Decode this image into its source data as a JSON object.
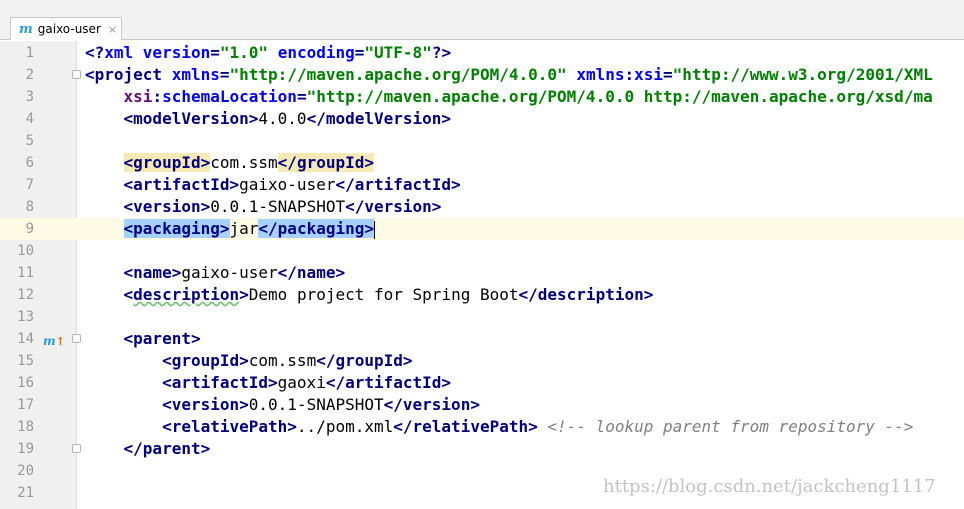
{
  "tab": {
    "icon": "m",
    "label": "gaixo-user",
    "close": "×"
  },
  "lines": [
    {
      "num": "1",
      "segs": [
        [
          "t",
          "<?"
        ],
        [
          "a",
          "xml version"
        ],
        [
          "t",
          "="
        ],
        [
          "v",
          "\"1.0\""
        ],
        [
          "t",
          " "
        ],
        [
          "a",
          "encoding"
        ],
        [
          "t",
          "="
        ],
        [
          "v",
          "\"UTF-8\""
        ],
        [
          "t",
          "?>"
        ]
      ]
    },
    {
      "num": "2",
      "segs": [
        [
          "t",
          "<project "
        ],
        [
          "a",
          "xmlns"
        ],
        [
          "t",
          "="
        ],
        [
          "v",
          "\"http://maven.apache.org/POM/4.0.0\""
        ],
        [
          "t",
          " "
        ],
        [
          "a",
          "xmlns"
        ],
        [
          "t",
          ":"
        ],
        [
          "a",
          "xsi"
        ],
        [
          "t",
          "="
        ],
        [
          "v",
          "\"http://www.w3.org/2001/XML"
        ]
      ]
    },
    {
      "num": "3",
      "segs": [
        [
          "x",
          "    xsi"
        ],
        [
          "t",
          ":"
        ],
        [
          "a",
          "schemaLocation"
        ],
        [
          "t",
          "="
        ],
        [
          "v",
          "\"http://maven.apache.org/POM/4.0.0 http://maven.apache.org/xsd/ma"
        ]
      ]
    },
    {
      "num": "4",
      "segs": [
        [
          "p",
          "    "
        ],
        [
          "t",
          "<modelVersion>"
        ],
        [
          "p",
          "4.0.0"
        ],
        [
          "t",
          "</modelVersion>"
        ]
      ]
    },
    {
      "num": "5",
      "segs": []
    },
    {
      "num": "6",
      "segs": [
        [
          "p",
          "    "
        ],
        [
          "ty",
          "<groupId>"
        ],
        [
          "p",
          "com.ssm"
        ],
        [
          "ty",
          "</groupId>"
        ]
      ]
    },
    {
      "num": "7",
      "segs": [
        [
          "p",
          "    "
        ],
        [
          "t",
          "<artifactId>"
        ],
        [
          "p",
          "gaixo-user"
        ],
        [
          "t",
          "</artifactId>"
        ]
      ]
    },
    {
      "num": "8",
      "segs": [
        [
          "p",
          "    "
        ],
        [
          "t",
          "<version>"
        ],
        [
          "p",
          "0.0.1-SNAPSHOT"
        ],
        [
          "t",
          "</version>"
        ]
      ]
    },
    {
      "num": "9",
      "segs": [
        [
          "p",
          "    "
        ],
        [
          "tb",
          "<packaging>"
        ],
        [
          "p",
          "jar"
        ],
        [
          "tb",
          "</packaging>"
        ],
        [
          "cursor",
          ""
        ]
      ]
    },
    {
      "num": "10",
      "segs": []
    },
    {
      "num": "11",
      "segs": [
        [
          "p",
          "    "
        ],
        [
          "t",
          "<name>"
        ],
        [
          "p",
          "gaixo-user"
        ],
        [
          "t",
          "</name>"
        ]
      ]
    },
    {
      "num": "12",
      "segs": [
        [
          "p",
          "    "
        ],
        [
          "t",
          "<"
        ],
        [
          "ts",
          "description"
        ],
        [
          "t",
          ">"
        ],
        [
          "p",
          "Demo project for Spring Boot"
        ],
        [
          "t",
          "</description>"
        ]
      ]
    },
    {
      "num": "13",
      "segs": []
    },
    {
      "num": "14",
      "segs": [
        [
          "p",
          "    "
        ],
        [
          "t",
          "<parent>"
        ]
      ]
    },
    {
      "num": "15",
      "segs": [
        [
          "p",
          "        "
        ],
        [
          "t",
          "<groupId>"
        ],
        [
          "p",
          "com.ssm"
        ],
        [
          "t",
          "</groupId>"
        ]
      ]
    },
    {
      "num": "16",
      "segs": [
        [
          "p",
          "        "
        ],
        [
          "t",
          "<artifactId>"
        ],
        [
          "p",
          "gaoxi"
        ],
        [
          "t",
          "</artifactId>"
        ]
      ]
    },
    {
      "num": "17",
      "segs": [
        [
          "p",
          "        "
        ],
        [
          "t",
          "<version>"
        ],
        [
          "p",
          "0.0.1-SNAPSHOT"
        ],
        [
          "t",
          "</version>"
        ]
      ]
    },
    {
      "num": "18",
      "segs": [
        [
          "p",
          "        "
        ],
        [
          "t",
          "<relativePath>"
        ],
        [
          "p",
          "../pom.xml"
        ],
        [
          "t",
          "</relativePath>"
        ],
        [
          "p",
          " "
        ],
        [
          "c",
          "<!-- lookup parent from repository -->"
        ]
      ]
    },
    {
      "num": "19",
      "segs": [
        [
          "p",
          "    "
        ],
        [
          "t",
          "</parent>"
        ]
      ]
    },
    {
      "num": "20",
      "segs": []
    },
    {
      "num": "21",
      "segs": []
    }
  ],
  "fold_lines": [
    2,
    14,
    19
  ],
  "current_line": 9,
  "gutter_marker": {
    "line": 14,
    "icon": "m",
    "arrow": "↑",
    "name": "maven-parent-icon"
  },
  "watermark": "https://blog.csdn.net/jackcheng1117"
}
